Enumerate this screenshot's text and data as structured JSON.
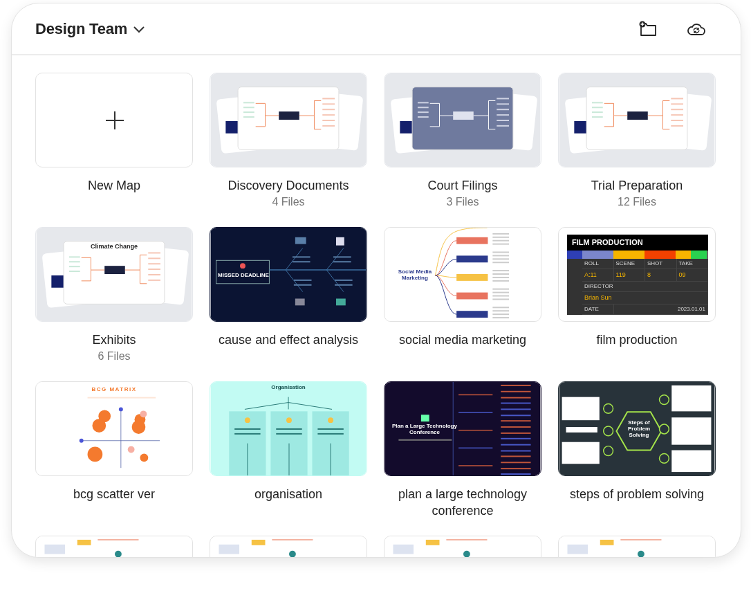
{
  "header": {
    "title": "Design Team"
  },
  "items": [
    {
      "kind": "new",
      "label": "New Map"
    },
    {
      "kind": "folder",
      "label": "Discovery Documents",
      "count": "4 Files"
    },
    {
      "kind": "folder-slate",
      "label": "Court Filings",
      "count": "3 Files"
    },
    {
      "kind": "folder",
      "label": "Trial Preparation",
      "count": "12 Files"
    },
    {
      "kind": "folder",
      "label": "Exhibits",
      "count": "6 Files",
      "preview_title": "Climate Change"
    },
    {
      "kind": "fishbone",
      "label": "cause and effect analysis",
      "preview_title": "MISSED DEADLINE"
    },
    {
      "kind": "mindmap",
      "label": "social media marketing",
      "preview_title": "Social Media Marketing"
    },
    {
      "kind": "clapper",
      "label": "film production",
      "film": {
        "title": "FILM PRODUCTION",
        "headers": [
          "ROLL",
          "SCENE",
          "SHOT",
          "TAKE"
        ],
        "values": [
          "A:11",
          "119",
          "8",
          "09"
        ],
        "director_label": "DIRECTOR",
        "director": "Brian Sun",
        "date_label": "DATE",
        "date": "2023.01.01"
      }
    },
    {
      "kind": "bubble",
      "label": "bcg scatter ver",
      "preview_title": "BCG MATRIX"
    },
    {
      "kind": "org",
      "label": "organisation",
      "preview_title": "Organisation"
    },
    {
      "kind": "darktree",
      "label": "plan a large technology conference",
      "preview_title": "Plan a Large Technology Conference"
    },
    {
      "kind": "hexagon",
      "label": "steps of problem solving",
      "preview_title": "Steps of Problem Solving"
    },
    {
      "kind": "stub"
    },
    {
      "kind": "stub"
    },
    {
      "kind": "stub"
    },
    {
      "kind": "stub"
    }
  ]
}
